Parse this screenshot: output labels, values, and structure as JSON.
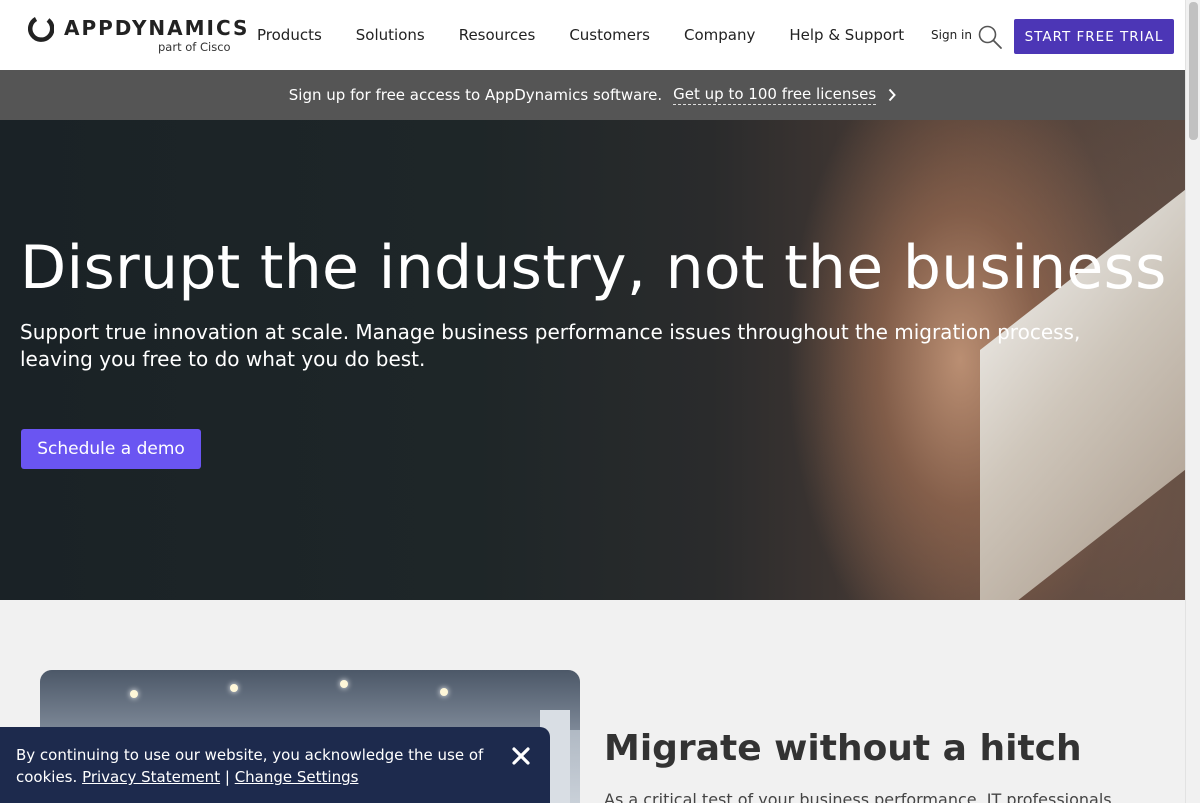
{
  "header": {
    "logo": {
      "wordmark": "APPDYNAMICS",
      "subtitle": "part of Cisco"
    },
    "nav": [
      "Products",
      "Solutions",
      "Resources",
      "Customers",
      "Company",
      "Help & Support"
    ],
    "sign_in": "Sign in",
    "search_icon": "search-icon",
    "cta": "START FREE TRIAL",
    "cta_color": "#4c36b6"
  },
  "announcement": {
    "text": "Sign up for free access to AppDynamics software.",
    "link": "Get up to 100 free licenses",
    "icon": "chevron-right-icon"
  },
  "hero": {
    "title": "Disrupt the industry, not the business",
    "subtitle": "Support true innovation at scale. Manage business performance issues throughout the migration process, leaving you free to do what you do best.",
    "button": "Schedule a demo",
    "button_color": "#6a55f2"
  },
  "section": {
    "title": "Migrate without a hitch",
    "body": "As a critical test of your business performance, IT professionals"
  },
  "cookie": {
    "text": "By continuing to use our website, you acknowledge the use of cookies.",
    "privacy_link": "Privacy Statement",
    "separator": "|",
    "settings_link": "Change Settings",
    "close_icon": "close-icon",
    "background": "#1d2a4d"
  }
}
